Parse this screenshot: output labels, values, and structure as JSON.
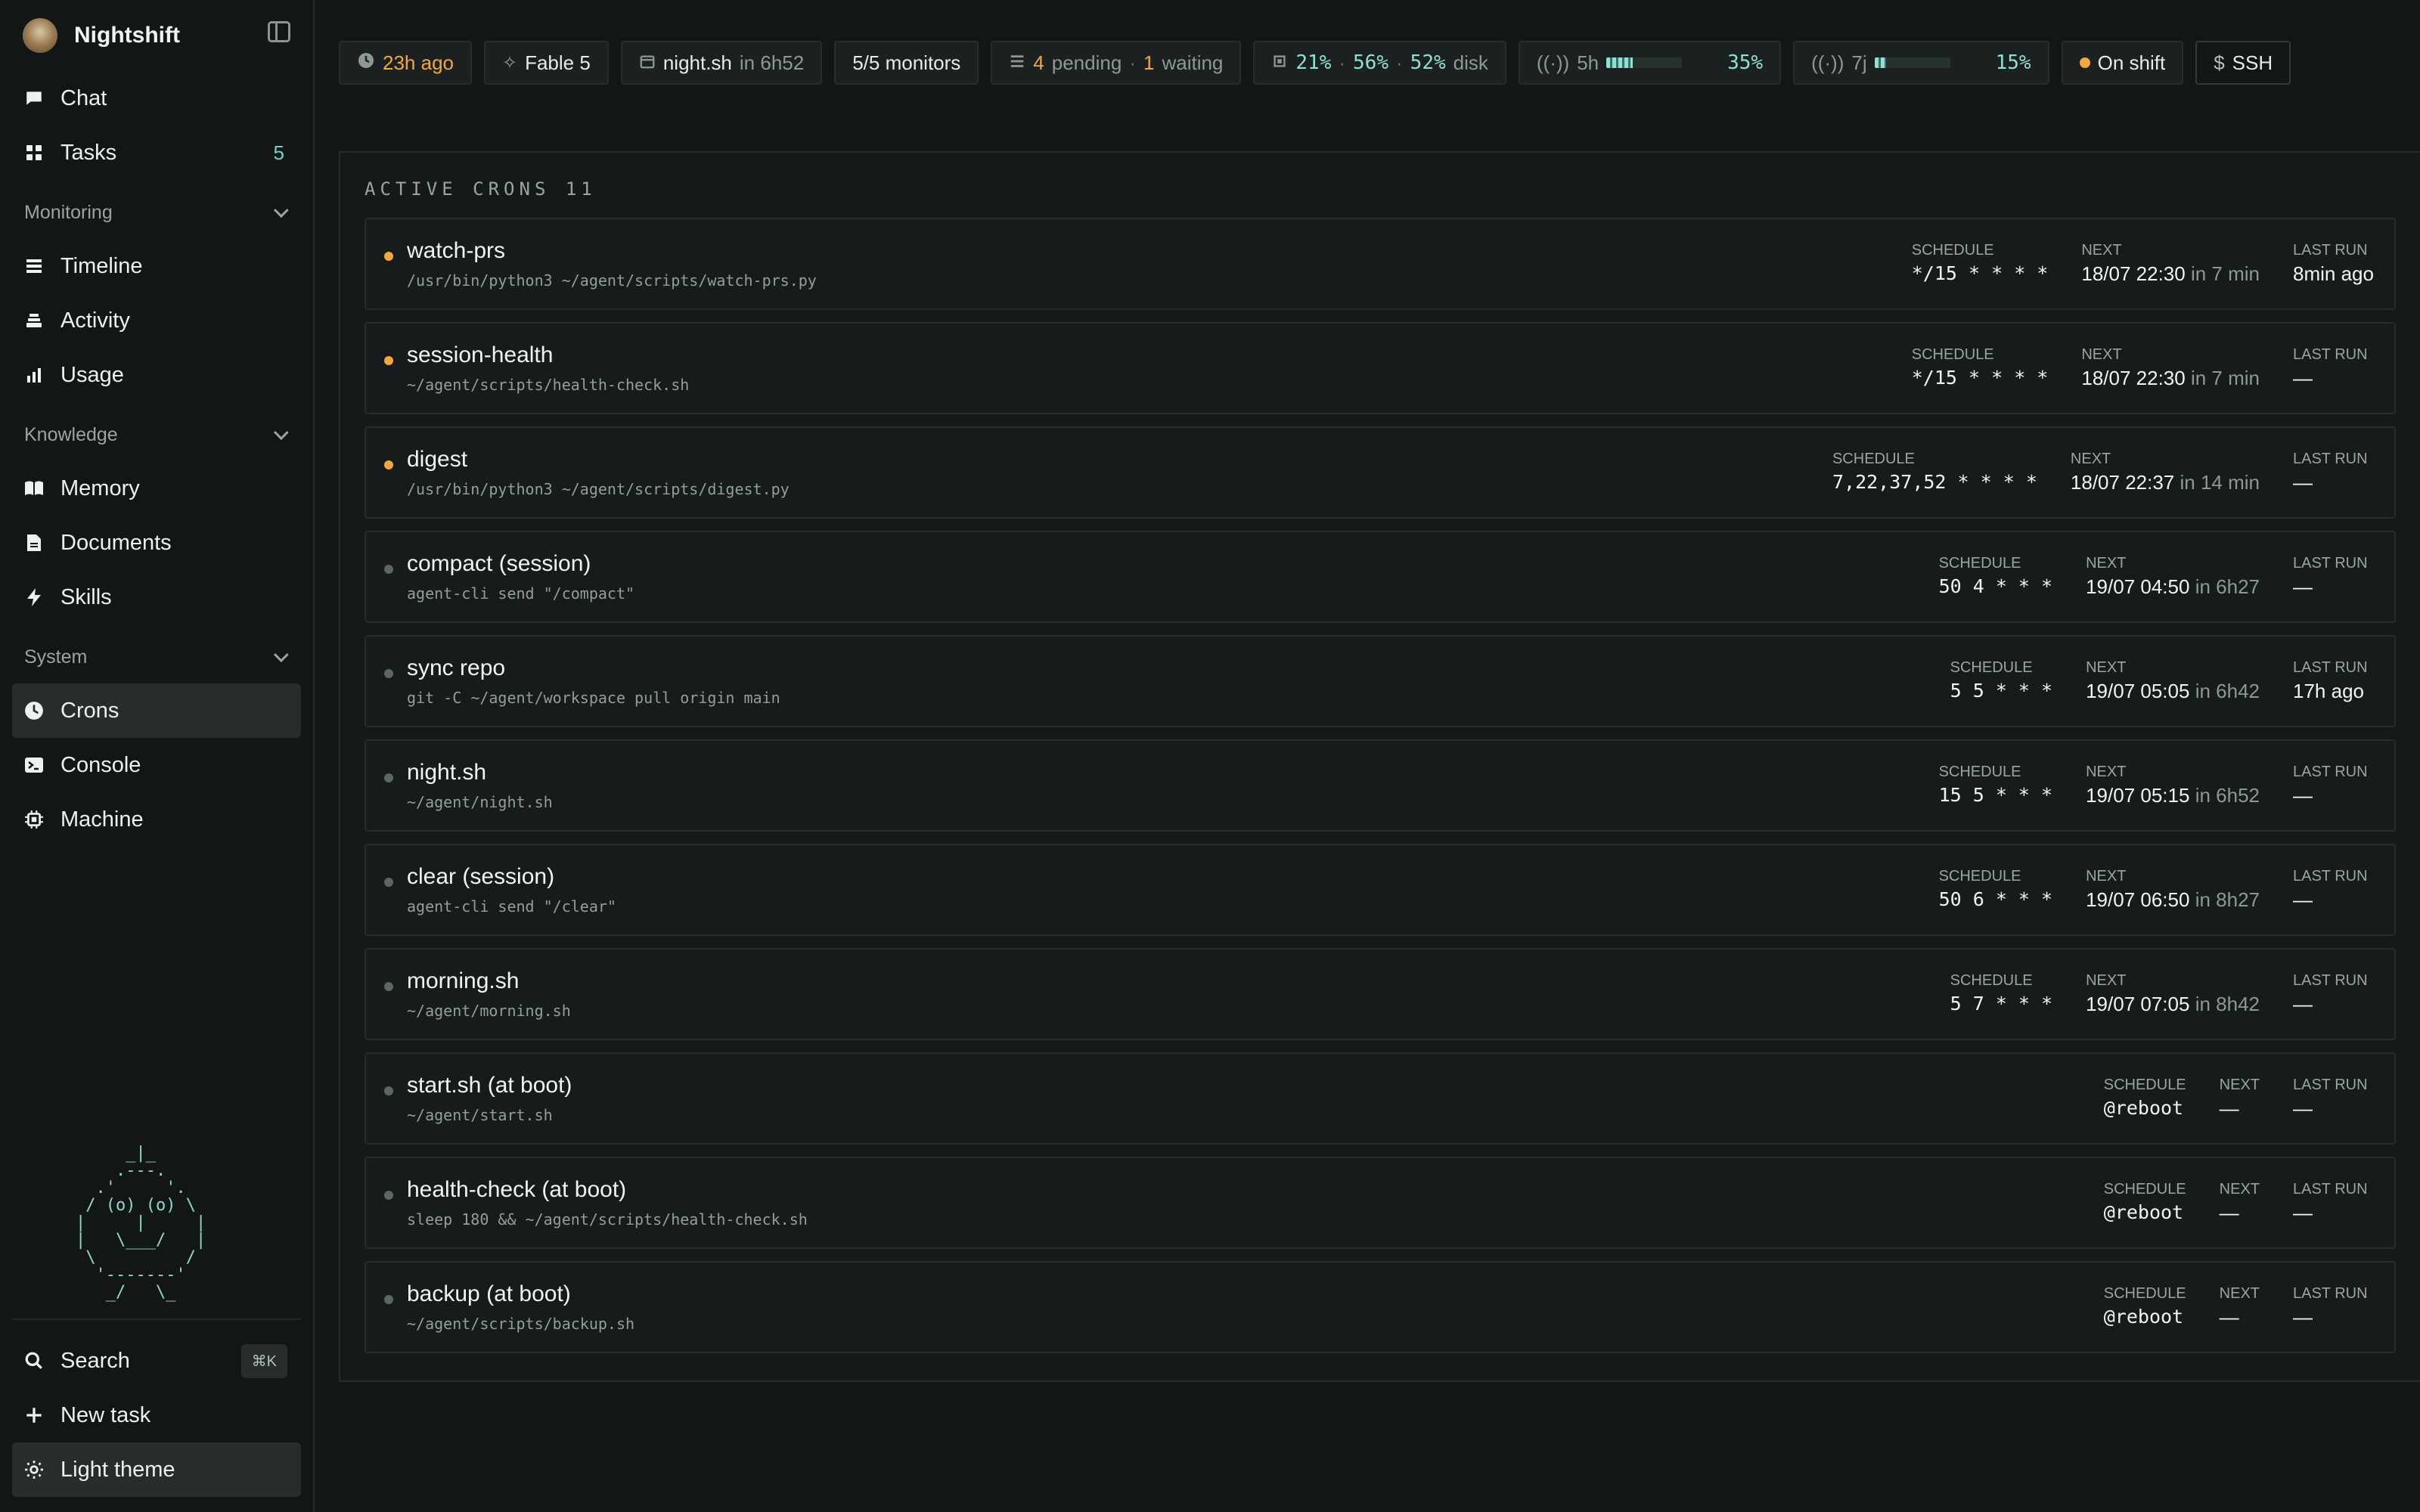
{
  "app": {
    "name": "Nightshift"
  },
  "sidebar": {
    "top": [
      {
        "icon": "chat-icon",
        "label": "Chat"
      },
      {
        "icon": "grid-icon",
        "label": "Tasks",
        "badge": "5"
      }
    ],
    "sections": [
      {
        "title": "Monitoring",
        "items": [
          {
            "icon": "timeline-icon",
            "label": "Timeline"
          },
          {
            "icon": "activity-icon",
            "label": "Activity"
          },
          {
            "icon": "bar-chart-icon",
            "label": "Usage"
          }
        ]
      },
      {
        "title": "Knowledge",
        "items": [
          {
            "icon": "book-icon",
            "label": "Memory"
          },
          {
            "icon": "document-icon",
            "label": "Documents"
          },
          {
            "icon": "bolt-icon",
            "label": "Skills"
          }
        ]
      },
      {
        "title": "System",
        "items": [
          {
            "icon": "clock-icon",
            "label": "Crons",
            "active": true
          },
          {
            "icon": "terminal-icon",
            "label": "Console"
          },
          {
            "icon": "chip-icon",
            "label": "Machine"
          }
        ]
      }
    ],
    "ascii": "     _|_\n    .---.\n  .'     '.\n / (o) (o) \\\n|     |     |\n|   \\___/   |\n \\         /\n  '-------'\n   _/   \\_",
    "bottom": {
      "search": "Search",
      "shortcut": "⌘K",
      "new_task": "New task",
      "theme": "Light theme"
    }
  },
  "topbar": {
    "last": "23h ago",
    "model": "Fable 5",
    "nightsh": {
      "name": "night.sh",
      "eta": "in 6h52"
    },
    "monitors": "5/5 monitors",
    "queue": {
      "pending": "4",
      "pending_label": "pending",
      "waiting": "1",
      "waiting_label": "waiting"
    },
    "resources": {
      "cpu": "21%",
      "mem": "56%",
      "disk": "52%",
      "disk_label": "disk"
    },
    "usage5h": {
      "label": "5h",
      "pct": "35%",
      "value": 0.35
    },
    "usage7j": {
      "label": "7j",
      "pct": "15%",
      "value": 0.15
    },
    "shift": "On shift",
    "ssh": "SSH"
  },
  "crons": {
    "title": "ACTIVE CRONS",
    "count": "11",
    "labels": {
      "schedule": "SCHEDULE",
      "next": "NEXT",
      "last": "LAST RUN"
    },
    "rows": [
      {
        "name": "watch-prs",
        "cmd": "/usr/bin/python3 ~/agent/scripts/watch-prs.py",
        "schedule": "*/15 * * * *",
        "next": "18/07 22:30",
        "in": "in 7 min",
        "last": "8min ago",
        "active": true
      },
      {
        "name": "session-health",
        "cmd": "~/agent/scripts/health-check.sh",
        "schedule": "*/15 * * * *",
        "next": "18/07 22:30",
        "in": "in 7 min",
        "last": "—",
        "active": true
      },
      {
        "name": "digest",
        "cmd": "/usr/bin/python3 ~/agent/scripts/digest.py",
        "schedule": "7,22,37,52 * * * *",
        "next": "18/07 22:37",
        "in": "in 14 min",
        "last": "—",
        "active": true
      },
      {
        "name": "compact (session)",
        "cmd": "agent-cli send \"/compact\"",
        "schedule": "50 4 * * *",
        "next": "19/07 04:50",
        "in": "in 6h27",
        "last": "—",
        "active": false
      },
      {
        "name": "sync repo",
        "cmd": "git -C ~/agent/workspace pull origin main",
        "schedule": "5 5 * * *",
        "next": "19/07 05:05",
        "in": "in 6h42",
        "last": "17h ago",
        "active": false
      },
      {
        "name": "night.sh",
        "cmd": "~/agent/night.sh",
        "schedule": "15 5 * * *",
        "next": "19/07 05:15",
        "in": "in 6h52",
        "last": "—",
        "active": false
      },
      {
        "name": "clear (session)",
        "cmd": "agent-cli send \"/clear\"",
        "schedule": "50 6 * * *",
        "next": "19/07 06:50",
        "in": "in 8h27",
        "last": "—",
        "active": false
      },
      {
        "name": "morning.sh",
        "cmd": "~/agent/morning.sh",
        "schedule": "5 7 * * *",
        "next": "19/07 07:05",
        "in": "in 8h42",
        "last": "—",
        "active": false
      },
      {
        "name": "start.sh (at boot)",
        "cmd": "~/agent/start.sh",
        "schedule": "@reboot",
        "next": "—",
        "in": "",
        "last": "—",
        "active": false
      },
      {
        "name": "health-check (at boot)",
        "cmd": "sleep 180 && ~/agent/scripts/health-check.sh",
        "schedule": "@reboot",
        "next": "—",
        "in": "",
        "last": "—",
        "active": false
      },
      {
        "name": "backup (at boot)",
        "cmd": "~/agent/scripts/backup.sh",
        "schedule": "@reboot",
        "next": "—",
        "in": "",
        "last": "—",
        "active": false
      }
    ]
  },
  "colors": {
    "accent": "#8fe0d4",
    "warning": "#f4a83a",
    "background": "#121716"
  }
}
